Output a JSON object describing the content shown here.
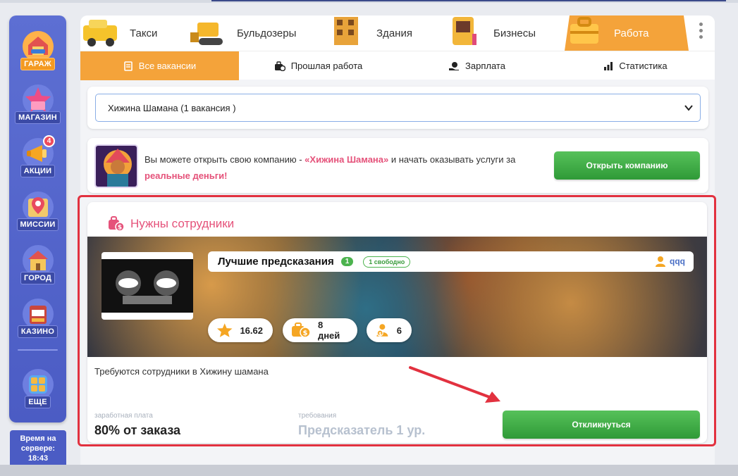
{
  "sidebar": {
    "items": [
      {
        "label": "ГАРАЖ"
      },
      {
        "label": "МАГАЗИН"
      },
      {
        "label": "АКЦИИ",
        "badge": "4"
      },
      {
        "label": "МИССИИ"
      },
      {
        "label": "ГОРОД"
      },
      {
        "label": "КАЗИНО"
      },
      {
        "label": "ЕЩЕ"
      }
    ],
    "server_time_label": "Время на сервере:",
    "server_time_value": "18:43"
  },
  "tabs": [
    {
      "label": "Такси"
    },
    {
      "label": "Бульдозеры"
    },
    {
      "label": "Здания"
    },
    {
      "label": "Бизнесы"
    },
    {
      "label": "Работа"
    }
  ],
  "subtabs": [
    {
      "label": "Все вакансии"
    },
    {
      "label": "Прошлая работа"
    },
    {
      "label": "Зарплата"
    },
    {
      "label": "Статистика"
    }
  ],
  "company_select": {
    "value": "Хижина Шамана (1 вакансия )"
  },
  "promo": {
    "text_before": "Вы можете открыть свою компанию - ",
    "company_name": "«Хижина Шамана»",
    "text_middle": " и начать оказывать услуги за ",
    "text_highlight": "реальные деньги!",
    "button_label": "Открыть компанию"
  },
  "job": {
    "section_title": "Нужны сотрудники",
    "company_title": "Лучшие предсказания",
    "level": "1",
    "free_slots": "1 свободно",
    "owner": "qqq",
    "rating": "16.62",
    "days": "8 дней",
    "employees": "6",
    "description": "Требуются сотрудники в Хижину шамана",
    "salary_label": "заработная плата",
    "salary_value": "80% от заказа",
    "requirements_label": "требования",
    "requirements_value": "Предсказатель 1 ур.",
    "apply_label": "Откликнуться"
  },
  "colors": {
    "accent_orange": "#f4a33a",
    "sidebar_blue": "#5d6fd3",
    "pink": "#e5527a",
    "green": "#3fae44",
    "highlight_red": "#e2313f"
  }
}
